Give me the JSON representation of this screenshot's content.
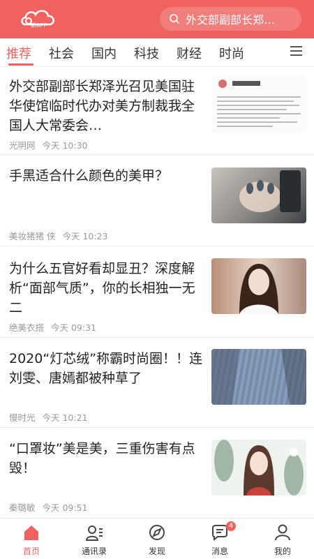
{
  "header": {
    "logo_text": "新APP",
    "search_placeholder": "外交部副部长郑…",
    "color": "#f0625f"
  },
  "tabs": [
    {
      "label": "推荐",
      "active": true
    },
    {
      "label": "社会"
    },
    {
      "label": "国内"
    },
    {
      "label": "科技"
    },
    {
      "label": "财经"
    },
    {
      "label": "时尚"
    }
  ],
  "articles": [
    {
      "title": "外交部副部长郑泽光召见美国驻华使馆临时代办对美方制裁我全国人大常委会…",
      "source": "光明网",
      "time": "今天 10:30",
      "thumb": "document-image"
    },
    {
      "title": "手黑适合什么颜色的美甲？",
      "source": "美妆猪猪 侠",
      "time": "今天 10:23",
      "thumb": "nails-image"
    },
    {
      "title": "为什么五官好看却显丑？深度解析“面部气质”，你的长相独一无二",
      "source": "绝美衣搭",
      "time": "今天 09:31",
      "thumb": "portrait-image"
    },
    {
      "title": "2020“灯芯绒”称霸时尚圈！！连刘雯、唐嫣都被种草了",
      "source": "慢时光",
      "time": "今天 10:21",
      "thumb": "corduroy-image"
    },
    {
      "title": "“口罩妆”美是美，三重伤害有点毁！",
      "source": "秦璐敏",
      "time": "今天 09:51",
      "thumb": "illustration-image"
    }
  ],
  "bottom_nav": [
    {
      "label": "首页",
      "icon": "home-icon",
      "active": true
    },
    {
      "label": "通讯录",
      "icon": "contacts-icon"
    },
    {
      "label": "发现",
      "icon": "discover-icon"
    },
    {
      "label": "消息",
      "icon": "message-icon",
      "badge": "4"
    },
    {
      "label": "我的",
      "icon": "profile-icon"
    }
  ]
}
